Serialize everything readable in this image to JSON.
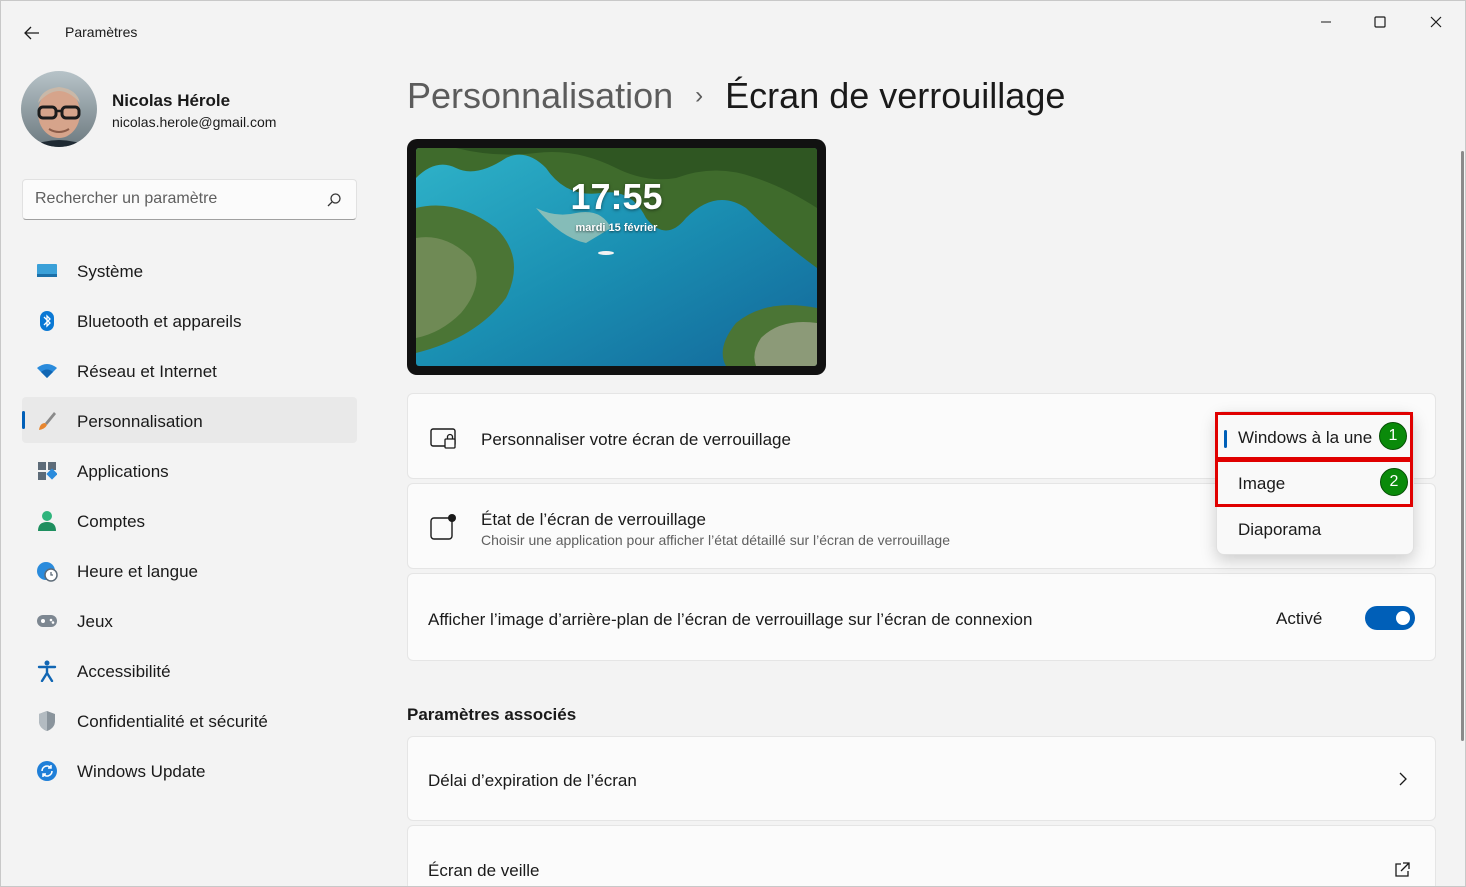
{
  "window": {
    "title": "Paramètres"
  },
  "user": {
    "name": "Nicolas Hérole",
    "email": "nicolas.herole@gmail.com"
  },
  "search": {
    "placeholder": "Rechercher un paramètre"
  },
  "sidebar": {
    "items": [
      {
        "label": "Système",
        "icon": "system-icon"
      },
      {
        "label": "Bluetooth et appareils",
        "icon": "bluetooth-icon"
      },
      {
        "label": "Réseau et Internet",
        "icon": "wifi-icon"
      },
      {
        "label": "Personnalisation",
        "icon": "brush-icon",
        "active": true
      },
      {
        "label": "Applications",
        "icon": "apps-icon"
      },
      {
        "label": "Comptes",
        "icon": "person-icon"
      },
      {
        "label": "Heure et langue",
        "icon": "globe-clock-icon"
      },
      {
        "label": "Jeux",
        "icon": "gamepad-icon"
      },
      {
        "label": "Accessibilité",
        "icon": "accessibility-icon"
      },
      {
        "label": "Confidentialité et sécurité",
        "icon": "shield-icon"
      },
      {
        "label": "Windows Update",
        "icon": "update-icon"
      }
    ]
  },
  "breadcrumb": {
    "parent": "Personnalisation",
    "separator": "›",
    "current": "Écran de verrouillage"
  },
  "preview": {
    "time": "17:55",
    "date": "mardi 15 février"
  },
  "cards": {
    "personalize": {
      "title": "Personnaliser votre écran de verrouillage"
    },
    "status": {
      "title": "État de l’écran de verrouillage",
      "subtitle": "Choisir une application pour afficher l’état détaillé sur l’écran de verrouillage"
    },
    "signin_bg": {
      "title": "Afficher l’image d’arrière-plan de l’écran de verrouillage sur l’écran de connexion",
      "toggle_label": "Activé",
      "toggle_on": true
    }
  },
  "dropdown": {
    "options": [
      "Windows à la une",
      "Image",
      "Diaporama"
    ],
    "selected": "Windows à la une"
  },
  "annotations": {
    "badge1": "1",
    "badge2": "2"
  },
  "related": {
    "title": "Paramètres associés",
    "items": [
      {
        "label": "Délai d’expiration de l’écran",
        "icon": "chevron-right-icon"
      },
      {
        "label": "Écran de veille",
        "icon": "external-link-icon"
      }
    ]
  },
  "colors": {
    "accent": "#005fb8",
    "highlight": "#e00000",
    "badge": "#0a8a0a"
  }
}
